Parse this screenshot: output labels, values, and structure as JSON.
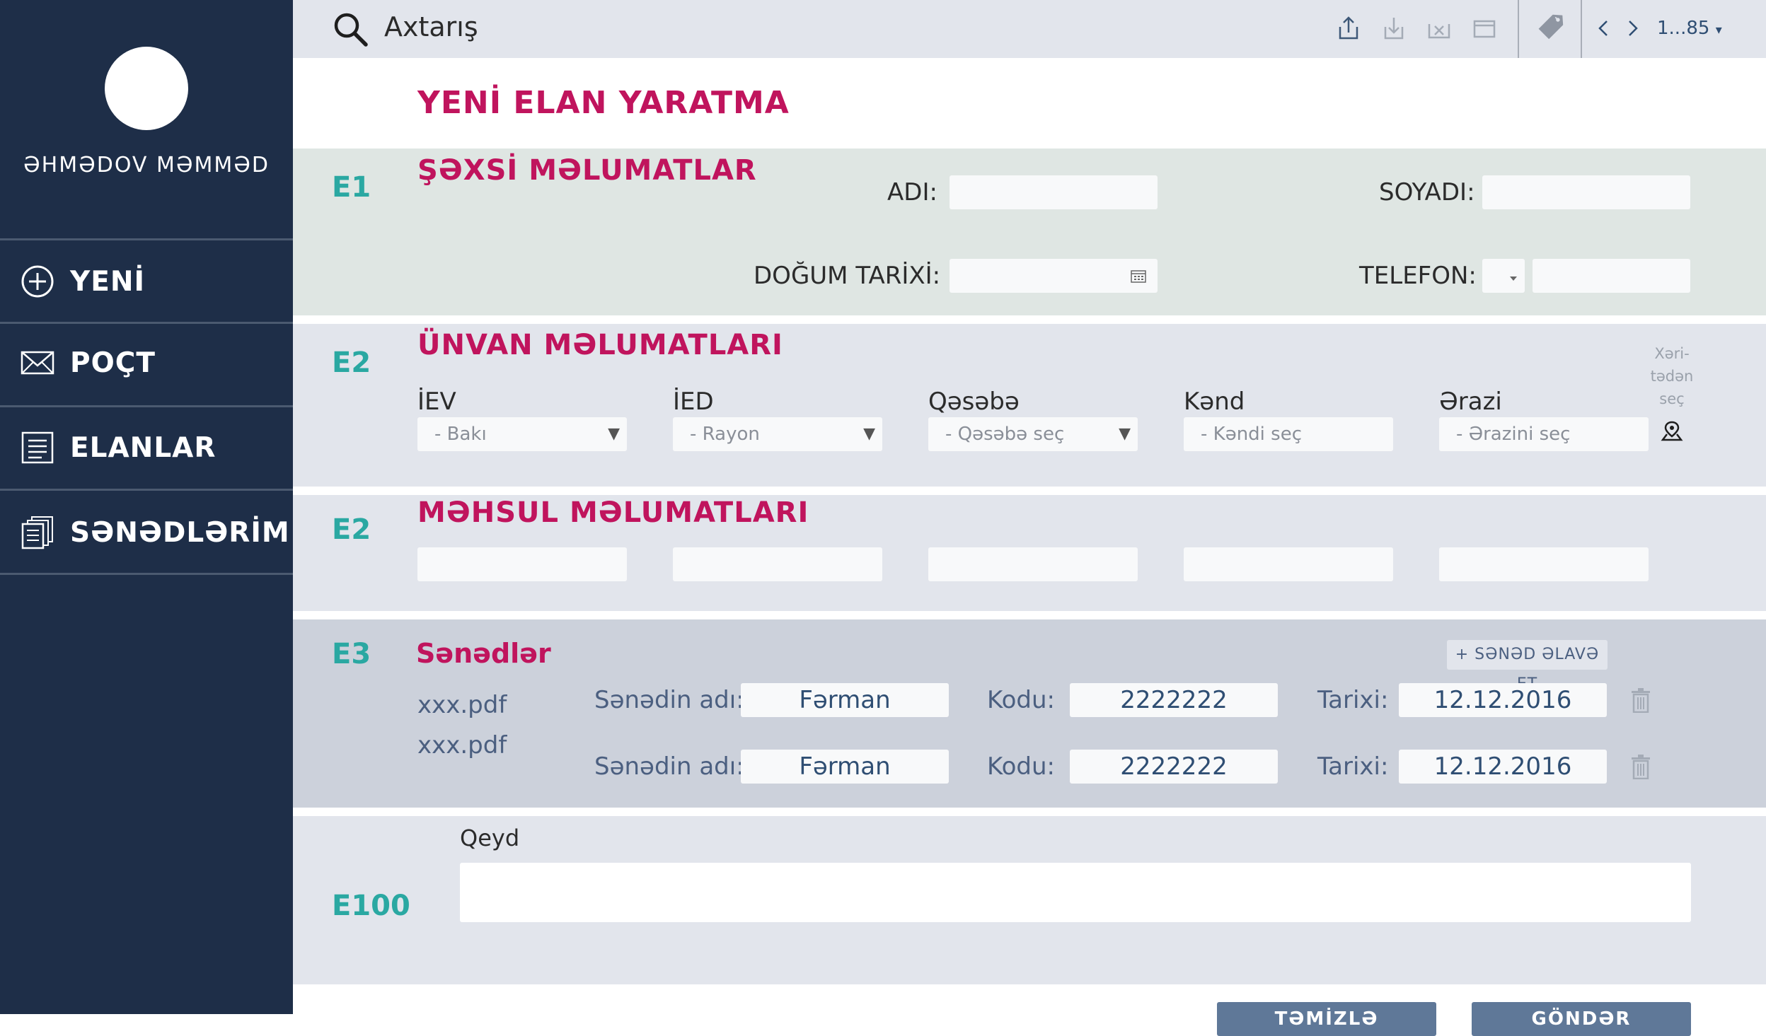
{
  "sidebar": {
    "user_name": "ƏHMƏDOV MƏMMƏD",
    "items": [
      {
        "label": "YENİ",
        "icon": "plus-circle-icon"
      },
      {
        "label": "POÇT",
        "icon": "envelope-icon"
      },
      {
        "label": "ELANLAR",
        "icon": "list-document-icon"
      },
      {
        "label": "SƏNƏDLƏRİM",
        "icon": "documents-stack-icon"
      }
    ]
  },
  "topbar": {
    "search_label": "Axtarış",
    "pager_label": "1...85",
    "pager_arrow": "▾"
  },
  "page": {
    "title": "YENİ ELAN YARATMA"
  },
  "personal": {
    "number": "E1",
    "title": "ŞƏXSİ MƏLUMATLAR",
    "name_label": "ADI:",
    "surname_label": "SOYADI:",
    "birth_label": "DOĞUM TARİXİ:",
    "phone_label": "TELEFON:"
  },
  "address": {
    "number": "E2",
    "title": "ÜNVAN MƏLUMATLARI",
    "map_hint": [
      "Xəri-",
      "tədən",
      "seç"
    ],
    "fields": [
      {
        "label": "İEV",
        "placeholder": "- Bakı",
        "arrow": "▼"
      },
      {
        "label": "İED",
        "placeholder": "- Rayon",
        "arrow": "▼"
      },
      {
        "label": "Qəsəbə",
        "placeholder": "- Qəsəbə seç",
        "arrow": "▼"
      },
      {
        "label": "Kənd",
        "placeholder": "- Kəndi seç"
      },
      {
        "label": "Ərazi",
        "placeholder": "- Ərazini seç"
      }
    ]
  },
  "product": {
    "number": "E2",
    "title": "MƏHSUL MƏLUMATLARI"
  },
  "documents": {
    "number": "E3",
    "title": "Sənədlər",
    "add_button": "+ SƏNƏD ƏLAVƏ ET",
    "files": [
      "xxx.pdf",
      "xxx.pdf"
    ],
    "rows": [
      {
        "name_label": "Sənədin adı:",
        "name": "Fərman",
        "code_label": "Kodu:",
        "code": "2222222",
        "date_label": "Tarixi:",
        "date": "12.12.2016"
      },
      {
        "name_label": "Sənədin adı:",
        "name": "Fərman",
        "code_label": "Kodu:",
        "code": "2222222",
        "date_label": "Tarixi:",
        "date": "12.12.2016"
      }
    ]
  },
  "note": {
    "number": "E100",
    "label": "Qeyd"
  },
  "actions": {
    "clear": "TƏMİZLƏ",
    "submit": "GÖNDƏR"
  },
  "colors": {
    "sidebar": "#1e2e48",
    "accent": "#c0145d",
    "teal": "#2aa8a2",
    "button": "#5f7898"
  }
}
